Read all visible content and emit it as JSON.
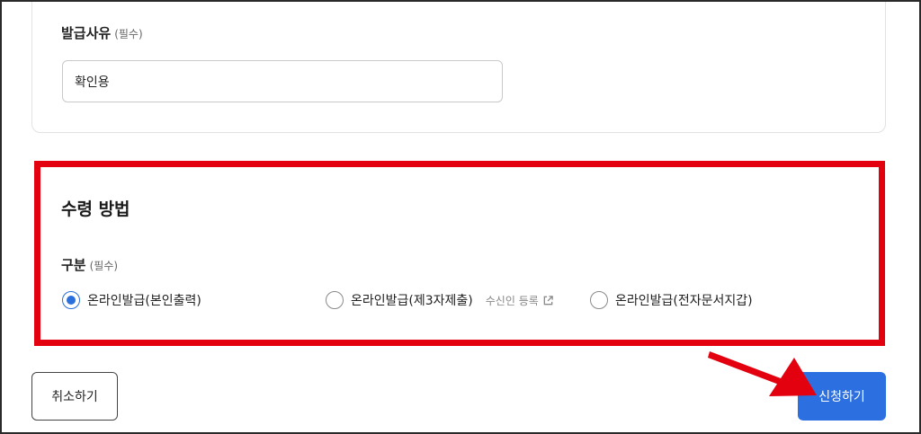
{
  "reason": {
    "label": "발급사유",
    "required": "(필수)",
    "value": "확인용"
  },
  "receipt": {
    "title": "수령 방법",
    "type_label": "구분",
    "required": "(필수)",
    "options": [
      {
        "label": "온라인발급(본인출력)",
        "selected": true
      },
      {
        "label": "온라인발급(제3자제출)",
        "selected": false,
        "link": "수신인 등록"
      },
      {
        "label": "온라인발급(전자문서지갑)",
        "selected": false
      }
    ]
  },
  "actions": {
    "cancel_label": "취소하기",
    "apply_label": "신청하기"
  },
  "colors": {
    "accent": "#2c6fe0",
    "highlight": "#e3000f"
  },
  "icons": [
    "external-link-icon",
    "red-arrow-annotation"
  ]
}
